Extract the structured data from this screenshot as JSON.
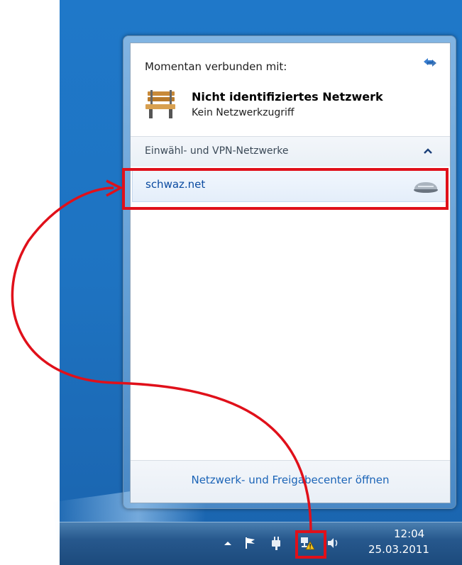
{
  "flyout": {
    "connected_label": "Momentan verbunden mit:",
    "network_name": "Nicht identifiziertes Netzwerk",
    "network_status": "Kein Netzwerkzugriff",
    "vpn_section_title": "Einwähl- und VPN-Netzwerke",
    "vpn_items": [
      {
        "label": "schwaz.net",
        "icon": "modem-icon"
      }
    ],
    "footer_link": "Netzwerk- und Freigabecenter öffnen"
  },
  "taskbar": {
    "tray_icons": [
      "show-hidden-icons-arrow",
      "action-center-flag-icon",
      "power-plug-icon",
      "network-warning-icon",
      "volume-icon"
    ],
    "clock_time": "12:04",
    "clock_date": "25.03.2011"
  },
  "colors": {
    "desktop_blue": "#1e73c1",
    "annotation_red": "#e0101a",
    "link_blue": "#1b64b7"
  }
}
